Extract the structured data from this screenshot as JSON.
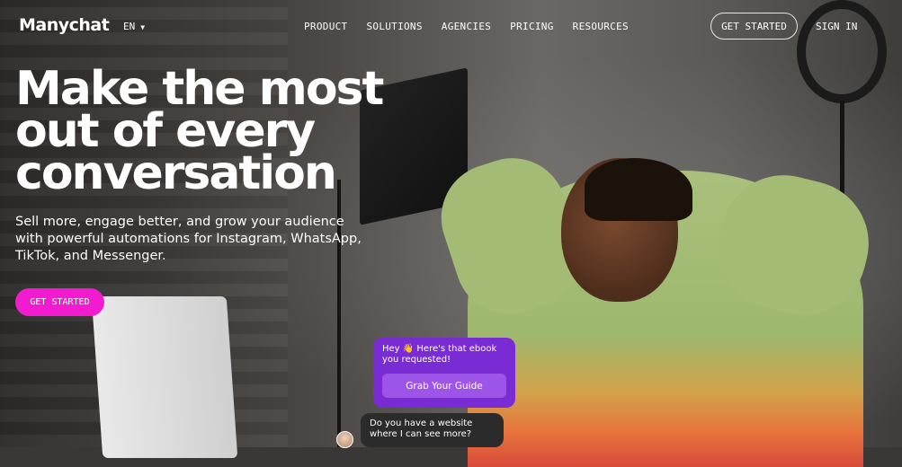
{
  "nav": {
    "logo": "Manychat",
    "language": "EN",
    "menu": [
      "PRODUCT",
      "SOLUTIONS",
      "AGENCIES",
      "PRICING",
      "RESOURCES"
    ],
    "get_started": "GET STARTED",
    "sign_in": "SIGN IN"
  },
  "hero": {
    "title_lines": [
      "Make the most",
      "out of every",
      "conversation"
    ],
    "subtitle": "Sell more, engage better, and grow your audience with powerful automations for Instagram, WhatsApp, TikTok, and Messenger.",
    "cta": "GET STARTED"
  },
  "chat": {
    "bot_message": "Hey 👋 Here's that ebook you requested!",
    "guide_button": "Grab Your Guide",
    "user_message": "Do you have a website where I can see more?"
  },
  "colors": {
    "accent_pink": "#f21bd0",
    "chat_purple": "#7a2cd4",
    "chat_button": "#9c55e6",
    "chat_dark": "#2b2b2b"
  }
}
